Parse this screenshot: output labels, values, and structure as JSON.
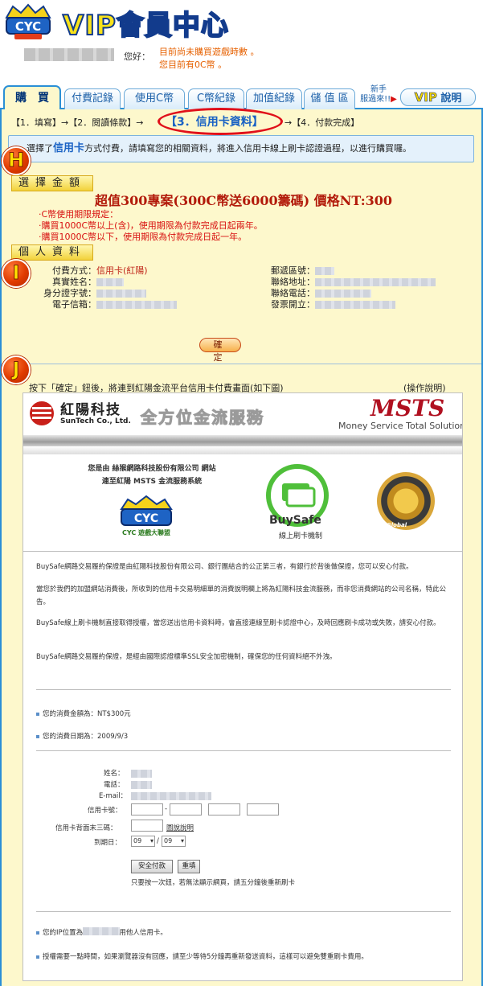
{
  "header": {
    "title": "VIP會員中心",
    "logo_text": "CYC",
    "hello": "您好：",
    "message_line1": "目前尚未購買遊戲時數 。",
    "message_line2": "您目前有0C幣 。"
  },
  "tabs": [
    {
      "label": "購　買",
      "active": true
    },
    {
      "label": "付費記錄",
      "active": false
    },
    {
      "label": "使用C幣",
      "active": false
    },
    {
      "label": "C幣紀錄",
      "active": false
    },
    {
      "label": "加值紀錄",
      "active": false
    },
    {
      "label": "儲 值 區",
      "active": false
    }
  ],
  "tab_new": {
    "line1": "新手",
    "line2": "服過來!!"
  },
  "vip_button": {
    "vip": "VIP",
    "label": "說明"
  },
  "steps": {
    "s1": "【1．填寫】→【2．閱讀條款】→",
    "s3": "【3．信用卡資料】",
    "s4": "→【4．付款完成】"
  },
  "notice": {
    "pre": "選擇了",
    "card": "信用卡",
    "post": "方式付費，請填寫您的相關資料，將進入信用卡線上刷卡認證過程，以進行購買囉。"
  },
  "markers": {
    "h": "H",
    "i": "I",
    "j": "J"
  },
  "section_amount": {
    "label": "選擇金額",
    "title": "超值300專案(300C幣送6000籌碼) 價格NT:300",
    "rules": [
      "‧C幣使用期限規定：",
      "‧購買1000C幣以上(含)，使用期限為付款完成日起兩年。",
      "‧購買1000C幣以下，使用期限為付款完成日起一年。"
    ]
  },
  "section_personal": {
    "label": "個人資料",
    "left": [
      {
        "label": "付費方式：",
        "value": "信用卡(紅陽)"
      },
      {
        "label": "真實姓名：",
        "value": ""
      },
      {
        "label": "身分證字號：",
        "value": ""
      },
      {
        "label": "電子信箱：",
        "value": ""
      }
    ],
    "right": [
      {
        "label": "郵遞區號：",
        "value": ""
      },
      {
        "label": "聯絡地址：",
        "value": ""
      },
      {
        "label": "聯絡電話：",
        "value": ""
      },
      {
        "label": "發票開立：",
        "value": ""
      }
    ]
  },
  "confirm_button": "確　定",
  "j_text": "按下「確定」鈕後，將連到紅陽金流平台信用卡付費畫面(如下圖)",
  "help_link": "(操作說明)",
  "embed": {
    "company_cn": "紅陽科技",
    "company_en": "SunTech Co., Ltd.",
    "slogan": "全方位金流服務",
    "msts": "MSTS",
    "msts_sub": "Money Service Total Solution",
    "from_line1": "您是由 絲猴網路科技股份有限公司 網站",
    "from_line2": "連至紅陽 MSTS 金流服務系統",
    "cyc_sub": "CYC 遊戲大聯盟",
    "buysafe": "BuySafe",
    "buysafe_sub": "線上刷卡機制",
    "seal_text": "Global",
    "paragraphs": [
      "BuySafe網路交易履約保證是由紅陽科技股份有限公司、銀行團結合的公正第三者，有銀行於背後做保證，您可以安心付款。",
      "當您於我們的加盟網站消費後，所收到的信用卡交易明細單的消費說明欄上將為紅陽科技金流服務，而非您消費網站的公司名稱，特此公告。",
      "BuySafe線上刷卡機制直接取得授權，當您送出信用卡資料時，會直接連線至刷卡認證中心，及時回應刷卡成功或失敗，請安心付款。",
      "BuySafe網路交易履約保證，是經由國際認證標準SSL安全加密機制，確保您的任何資料絕不外洩。"
    ],
    "amount_line": "您的消費金額為：NT$300元",
    "date_line": "您的消費日期為：2009/9/3",
    "form": {
      "name_label": "姓名：",
      "phone_label": "電話：",
      "email_label": "E-mail：",
      "card_label": "信用卡號：",
      "cvv_label": "信用卡背面末三碼：",
      "cvv_link": "圖說說明",
      "expiry_label": "到期日：",
      "month": "09",
      "year": "09",
      "submit": "安全付款",
      "reset": "重填",
      "hint": "只要按一次鈕，若無法顯示網頁，請五分鐘後重新刷卡"
    },
    "ip_line": "您的IP位置為                  請勿嘗試冒用他人信用卡。",
    "final_line": "授權需要一點時間，如果瀏覽器沒有回應，請至少等待5分鐘再重新發送資料，這樣可以避免雙重刷卡費用。"
  },
  "colors": {
    "accent": "#2a8fd6",
    "panel": "#fdf8cc",
    "warning": "#d81010",
    "marker": "#e03a00"
  }
}
